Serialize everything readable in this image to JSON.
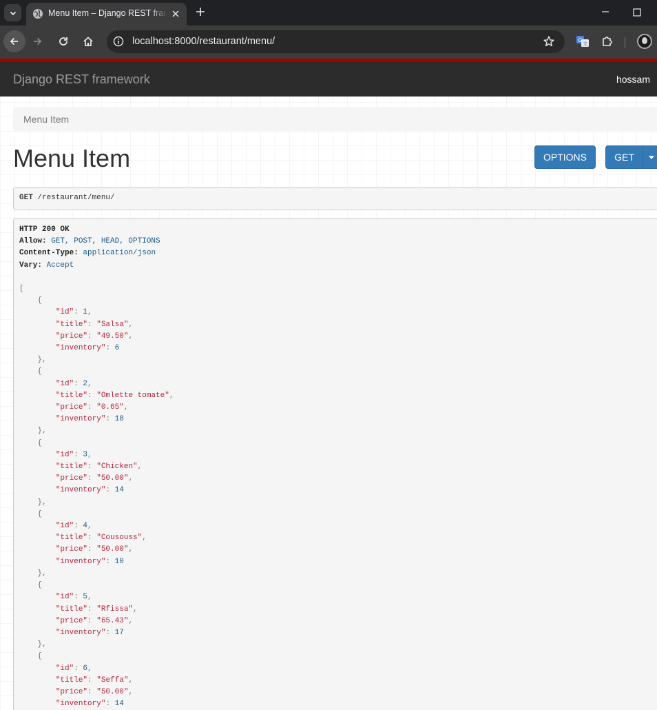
{
  "browser": {
    "tab_title": "Menu Item – Django REST framework",
    "url": "localhost:8000/restaurant/menu/"
  },
  "navbar": {
    "brand": "Django REST framework",
    "user": "hossam"
  },
  "breadcrumb": [
    "Menu Item"
  ],
  "page_title": "Menu Item",
  "buttons": {
    "options": "OPTIONS",
    "get": "GET"
  },
  "request": {
    "method": "GET",
    "path": " /restaurant/menu/"
  },
  "response": {
    "status": "HTTP 200 OK",
    "headers": [
      {
        "name": "Allow:",
        "value": " GET, POST, HEAD, OPTIONS"
      },
      {
        "name": "Content-Type:",
        "value": " application/json"
      },
      {
        "name": "Vary:",
        "value": " Accept"
      }
    ],
    "items": [
      {
        "id": 1,
        "title": "Salsa",
        "price": "49.50",
        "inventory": 6
      },
      {
        "id": 2,
        "title": "Omlette tomate",
        "price": "0.65",
        "inventory": 18
      },
      {
        "id": 3,
        "title": "Chicken",
        "price": "50.00",
        "inventory": 14
      },
      {
        "id": 4,
        "title": "Cousouss",
        "price": "50.00",
        "inventory": 10
      },
      {
        "id": 5,
        "title": "Rfissa",
        "price": "65.43",
        "inventory": 17
      },
      {
        "id": 6,
        "title": "Seffa",
        "price": "50.00",
        "inventory": 14
      }
    ]
  }
}
